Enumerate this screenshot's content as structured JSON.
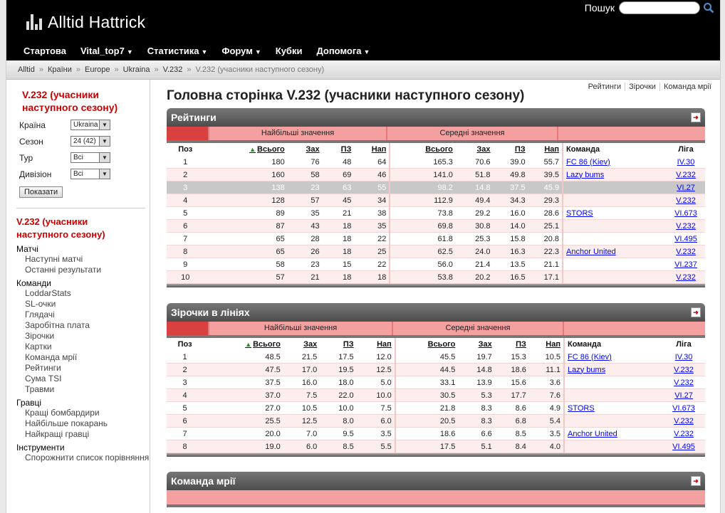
{
  "header": {
    "logo_text": "Alltid Hattrick",
    "search_label": "Пошук",
    "search_value": "",
    "nav": [
      {
        "label": "Стартова",
        "caret": false
      },
      {
        "label": "Vital_top7",
        "caret": true
      },
      {
        "label": "Статистика",
        "caret": true
      },
      {
        "label": "Форум",
        "caret": true
      },
      {
        "label": "Кубки",
        "caret": false
      },
      {
        "label": "Допомога",
        "caret": true
      }
    ]
  },
  "breadcrumb": {
    "items": [
      "Alltid",
      "Країни",
      "Europe",
      "Ukraina",
      "V.232"
    ],
    "current": "V.232 (учасники наступного сезону)",
    "sep": "»"
  },
  "sidebar": {
    "title": "V.232 (учасники наступного сезону)",
    "filters": [
      {
        "label": "Країна",
        "value": "Ukraina"
      },
      {
        "label": "Сезон",
        "value": "24 (42)"
      },
      {
        "label": "Тур",
        "value": "Всі"
      },
      {
        "label": "Дивізіон",
        "value": "Всі"
      }
    ],
    "show_button": "Показати",
    "nav_title": "V.232 (учасники наступного сезону)",
    "groups": [
      {
        "title": "Матчі",
        "links": [
          "Наступні матчі",
          "Останні результати"
        ]
      },
      {
        "title": "Команди",
        "links": [
          "LoddarStats",
          "SL-очки",
          "Глядачі",
          "Заробітна плата",
          "Зірочки",
          "Картки",
          "Команда мрії",
          "Рейтинги",
          "Сума TSI",
          "Травми"
        ]
      },
      {
        "title": "Гравці",
        "links": [
          "Кращі бомбардири",
          "Найбільше покарань",
          "Найкращі гравці"
        ]
      },
      {
        "title": "Інструменти",
        "links": [
          "Спорожнити список порівняння"
        ]
      }
    ]
  },
  "main": {
    "top_links": [
      "Рейтинги",
      "Зірочки",
      "Команда мрії"
    ],
    "heading": "Головна сторінка V.232 (учасники наступного сезону)",
    "ratings": {
      "title": "Рейтинги",
      "group_max": "Найбільші значення",
      "group_avg": "Середні значення",
      "columns": [
        "Поз",
        "Всього",
        "Зах",
        "ПЗ",
        "Нап",
        "Всього",
        "Зах",
        "ПЗ",
        "Нап",
        "Команда",
        "Ліга"
      ],
      "rows": [
        [
          "1",
          "180",
          "76",
          "48",
          "64",
          "165.3",
          "70.6",
          "39.0",
          "55.7",
          "FC 86 (Kiev)",
          "IV.30"
        ],
        [
          "2",
          "160",
          "58",
          "69",
          "46",
          "141.0",
          "51.8",
          "49.8",
          "39.5",
          "Lazy bums",
          "V.232"
        ],
        [
          "3",
          "138",
          "23",
          "63",
          "55",
          "98.2",
          "14.8",
          "37.5",
          "45.9",
          "",
          "VI.27"
        ],
        [
          "4",
          "128",
          "57",
          "45",
          "34",
          "112.9",
          "49.4",
          "34.3",
          "29.3",
          "",
          "V.232"
        ],
        [
          "5",
          "89",
          "35",
          "21",
          "38",
          "73.8",
          "29.2",
          "16.0",
          "28.6",
          "STORS",
          "VI.673"
        ],
        [
          "6",
          "87",
          "43",
          "18",
          "35",
          "69.8",
          "30.8",
          "14.0",
          "25.1",
          "",
          "V.232"
        ],
        [
          "7",
          "65",
          "28",
          "18",
          "22",
          "61.8",
          "25.3",
          "15.8",
          "20.8",
          "",
          "VI.495"
        ],
        [
          "8",
          "65",
          "26",
          "18",
          "25",
          "62.5",
          "24.0",
          "16.3",
          "22.3",
          "Anchor United",
          "V.232"
        ],
        [
          "9",
          "58",
          "23",
          "15",
          "22",
          "56.0",
          "21.4",
          "13.5",
          "21.1",
          "",
          "VI.237"
        ],
        [
          "10",
          "57",
          "21",
          "18",
          "18",
          "53.8",
          "20.2",
          "16.5",
          "17.1",
          "",
          "V.232"
        ]
      ]
    },
    "stars": {
      "title": "Зірочки в лініях",
      "group_max": "Найбільші значення",
      "group_avg": "Середні значення",
      "columns": [
        "Поз",
        "Всього",
        "Зах",
        "ПЗ",
        "Нап",
        "Всього",
        "Зах",
        "ПЗ",
        "Нап",
        "Команда",
        "Ліга"
      ],
      "rows": [
        [
          "1",
          "48.5",
          "21.5",
          "17.5",
          "12.0",
          "45.5",
          "19.7",
          "15.3",
          "10.5",
          "FC 86 (Kiev)",
          "IV.30"
        ],
        [
          "2",
          "47.5",
          "17.0",
          "19.5",
          "12.5",
          "44.5",
          "14.8",
          "18.6",
          "11.1",
          "Lazy bums",
          "V.232"
        ],
        [
          "3",
          "37.5",
          "16.0",
          "18.0",
          "5.0",
          "33.1",
          "13.9",
          "15.6",
          "3.6",
          "",
          "V.232"
        ],
        [
          "4",
          "37.0",
          "7.5",
          "22.0",
          "10.0",
          "30.5",
          "5.3",
          "17.7",
          "7.6",
          "",
          "VI.27"
        ],
        [
          "5",
          "27.0",
          "10.5",
          "10.0",
          "7.5",
          "21.8",
          "8.3",
          "8.6",
          "4.9",
          "STORS",
          "VI.673"
        ],
        [
          "6",
          "25.5",
          "12.5",
          "8.0",
          "6.0",
          "20.5",
          "8.3",
          "6.8",
          "5.4",
          "",
          "V.232"
        ],
        [
          "7",
          "20.0",
          "7.0",
          "9.5",
          "3.5",
          "18.6",
          "6.6",
          "8.5",
          "3.5",
          "Anchor United",
          "V.232"
        ],
        [
          "8",
          "19.0",
          "6.0",
          "8.5",
          "5.5",
          "17.5",
          "5.1",
          "8.4",
          "4.0",
          "",
          "VI.495"
        ]
      ]
    },
    "dream": {
      "title": "Команда мрії"
    }
  }
}
